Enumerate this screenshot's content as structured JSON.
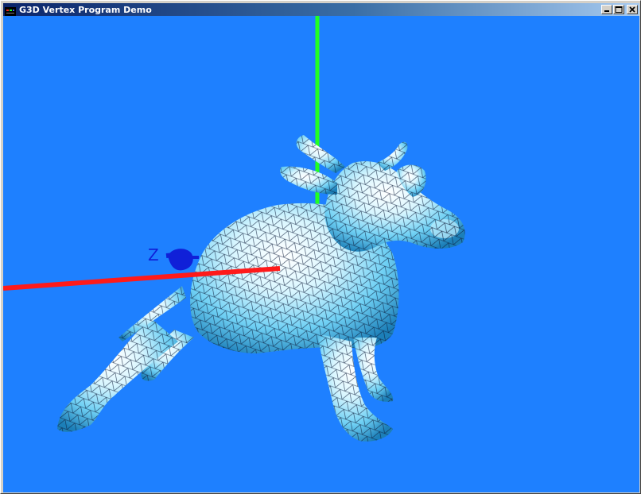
{
  "window": {
    "title": "G3D Vertex Program Demo",
    "controls": {
      "minimize": "minimize-icon",
      "maximize": "maximize-icon",
      "close": "close-icon"
    }
  },
  "scene": {
    "background_color": "#1e80ff",
    "axes": {
      "x_color": "#ff1a1a",
      "y_color": "#22ff22",
      "z_color": "#1020d8",
      "z_label": "Z"
    },
    "model": "cow-wireframe-model"
  }
}
